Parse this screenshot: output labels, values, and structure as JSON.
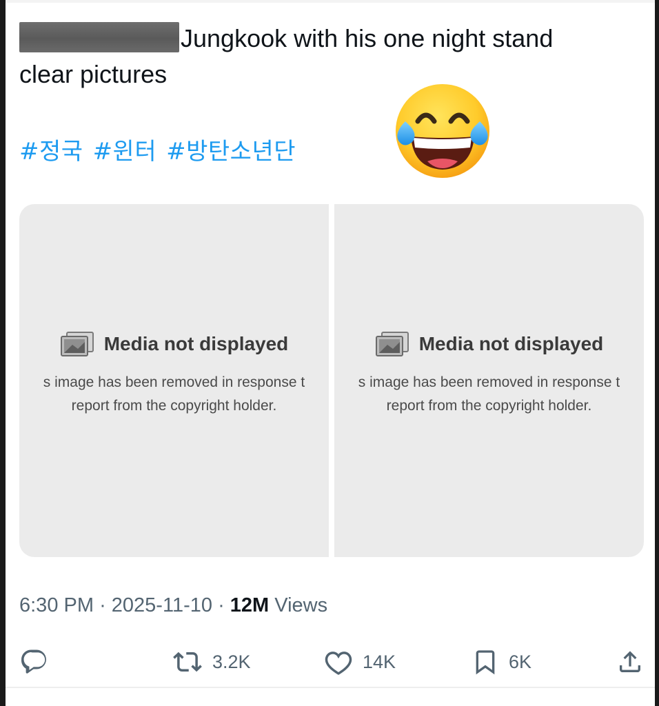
{
  "tweet": {
    "text": "Jungkook with his one night stand clear pictures",
    "text_line1": "Jungkook with his one night stand",
    "text_line2": "clear pictures",
    "hashtags": [
      "#정국",
      "#윈터",
      "#방탄소년단"
    ],
    "emoji": "face-with-tears-of-joy"
  },
  "media": [
    {
      "title": "Media not displayed",
      "desc_line1": "s image has been removed in response t",
      "desc_line2": "report from the copyright holder."
    },
    {
      "title": "Media not displayed",
      "desc_line1": "s image has been removed in response t",
      "desc_line2": "report from the copyright holder."
    }
  ],
  "meta": {
    "time": "6:30 PM",
    "separator": "·",
    "date": "2025-11-10",
    "views_count": "12M",
    "views_label": "Views"
  },
  "actions": {
    "reply_icon": "reply-icon",
    "retweet_icon": "retweet-icon",
    "retweet_count": "3.2K",
    "like_icon": "heart-icon",
    "like_count": "14K",
    "bookmark_icon": "bookmark-icon",
    "bookmark_count": "6K",
    "share_icon": "share-icon"
  },
  "colors": {
    "hashtag": "#1d9bf0",
    "secondary_text": "#536471",
    "media_bg": "#ebebeb"
  }
}
